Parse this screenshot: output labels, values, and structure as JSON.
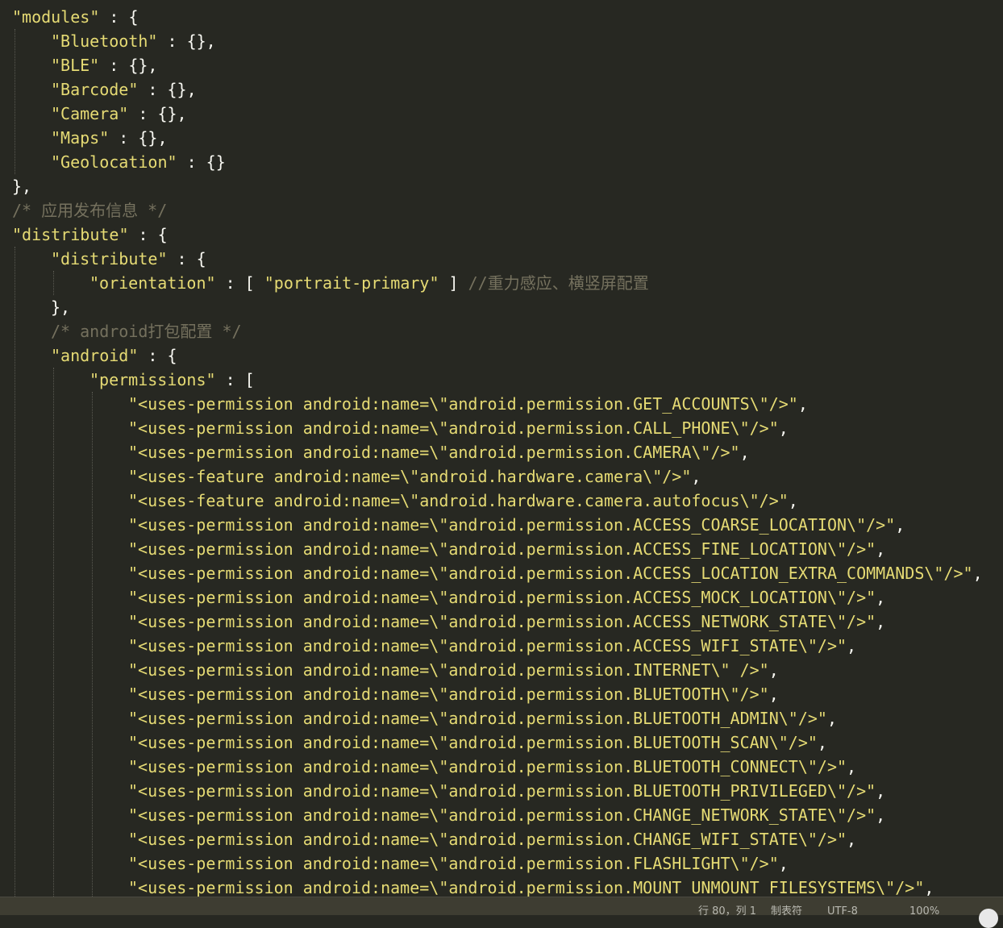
{
  "lines": [
    [
      {
        "t": "\"modules\"",
        "c": "k"
      },
      {
        "t": " : {",
        "c": "p"
      }
    ],
    [
      {
        "t": "\"Bluetooth\"",
        "c": "k"
      },
      {
        "t": " : {},",
        "c": "p"
      }
    ],
    [
      {
        "t": "\"BLE\"",
        "c": "k"
      },
      {
        "t": " : {},",
        "c": "p"
      }
    ],
    [
      {
        "t": "\"Barcode\"",
        "c": "k"
      },
      {
        "t": " : {},",
        "c": "p"
      }
    ],
    [
      {
        "t": "\"Camera\"",
        "c": "k"
      },
      {
        "t": " : {},",
        "c": "p"
      }
    ],
    [
      {
        "t": "\"Maps\"",
        "c": "k"
      },
      {
        "t": " : {},",
        "c": "p"
      }
    ],
    [
      {
        "t": "\"Geolocation\"",
        "c": "k"
      },
      {
        "t": " : {}",
        "c": "p"
      }
    ],
    [
      {
        "t": "},",
        "c": "p"
      }
    ],
    [
      {
        "t": "/* 应用发布信息 */",
        "c": "c"
      }
    ],
    [
      {
        "t": "\"distribute\"",
        "c": "k"
      },
      {
        "t": " : {",
        "c": "p"
      }
    ],
    [
      {
        "t": "\"distribute\"",
        "c": "k"
      },
      {
        "t": " : {",
        "c": "p"
      }
    ],
    [
      {
        "t": "\"orientation\"",
        "c": "k"
      },
      {
        "t": " : [ ",
        "c": "p"
      },
      {
        "t": "\"portrait-primary\"",
        "c": "k"
      },
      {
        "t": " ] ",
        "c": "p"
      },
      {
        "t": "//重力感应、横竖屏配置",
        "c": "c"
      }
    ],
    [
      {
        "t": "},",
        "c": "p"
      }
    ],
    [
      {
        "t": "/* android打包配置 */",
        "c": "c"
      }
    ],
    [
      {
        "t": "\"android\"",
        "c": "k"
      },
      {
        "t": " : {",
        "c": "p"
      }
    ],
    [
      {
        "t": "\"permissions\"",
        "c": "k"
      },
      {
        "t": " : [",
        "c": "p"
      }
    ],
    [
      {
        "t": "\"<uses-permission android:name=\\\"android.permission.GET_ACCOUNTS\\\"/>\"",
        "c": "k"
      },
      {
        "t": ",",
        "c": "p"
      }
    ],
    [
      {
        "t": "\"<uses-permission android:name=\\\"android.permission.CALL_PHONE\\\"/>\"",
        "c": "k"
      },
      {
        "t": ",",
        "c": "p"
      }
    ],
    [
      {
        "t": "\"<uses-permission android:name=\\\"android.permission.CAMERA\\\"/>\"",
        "c": "k"
      },
      {
        "t": ",",
        "c": "p"
      }
    ],
    [
      {
        "t": "\"<uses-feature android:name=\\\"android.hardware.camera\\\"/>\"",
        "c": "k"
      },
      {
        "t": ",",
        "c": "p"
      }
    ],
    [
      {
        "t": "\"<uses-feature android:name=\\\"android.hardware.camera.autofocus\\\"/>\"",
        "c": "k"
      },
      {
        "t": ",",
        "c": "p"
      }
    ],
    [
      {
        "t": "\"<uses-permission android:name=\\\"android.permission.ACCESS_COARSE_LOCATION\\\"/>\"",
        "c": "k"
      },
      {
        "t": ",",
        "c": "p"
      }
    ],
    [
      {
        "t": "\"<uses-permission android:name=\\\"android.permission.ACCESS_FINE_LOCATION\\\"/>\"",
        "c": "k"
      },
      {
        "t": ",",
        "c": "p"
      }
    ],
    [
      {
        "t": "\"<uses-permission android:name=\\\"android.permission.ACCESS_LOCATION_EXTRA_COMMANDS\\\"/>\"",
        "c": "k"
      },
      {
        "t": ",",
        "c": "p"
      }
    ],
    [
      {
        "t": "\"<uses-permission android:name=\\\"android.permission.ACCESS_MOCK_LOCATION\\\"/>\"",
        "c": "k"
      },
      {
        "t": ",",
        "c": "p"
      }
    ],
    [
      {
        "t": "\"<uses-permission android:name=\\\"android.permission.ACCESS_NETWORK_STATE\\\"/>\"",
        "c": "k"
      },
      {
        "t": ",",
        "c": "p"
      }
    ],
    [
      {
        "t": "\"<uses-permission android:name=\\\"android.permission.ACCESS_WIFI_STATE\\\"/>\"",
        "c": "k"
      },
      {
        "t": ",",
        "c": "p"
      }
    ],
    [
      {
        "t": "\"<uses-permission android:name=\\\"android.permission.INTERNET\\\" />\"",
        "c": "k"
      },
      {
        "t": ",",
        "c": "p"
      }
    ],
    [
      {
        "t": "\"<uses-permission android:name=\\\"android.permission.BLUETOOTH\\\"/>\"",
        "c": "k"
      },
      {
        "t": ",",
        "c": "p"
      }
    ],
    [
      {
        "t": "\"<uses-permission android:name=\\\"android.permission.BLUETOOTH_ADMIN\\\"/>\"",
        "c": "k"
      },
      {
        "t": ",",
        "c": "p"
      }
    ],
    [
      {
        "t": "\"<uses-permission android:name=\\\"android.permission.BLUETOOTH_SCAN\\\"/>\"",
        "c": "k"
      },
      {
        "t": ",",
        "c": "p"
      }
    ],
    [
      {
        "t": "\"<uses-permission android:name=\\\"android.permission.BLUETOOTH_CONNECT\\\"/>\"",
        "c": "k"
      },
      {
        "t": ",",
        "c": "p"
      }
    ],
    [
      {
        "t": "\"<uses-permission android:name=\\\"android.permission.BLUETOOTH_PRIVILEGED\\\"/>\"",
        "c": "k"
      },
      {
        "t": ",",
        "c": "p"
      }
    ],
    [
      {
        "t": "\"<uses-permission android:name=\\\"android.permission.CHANGE_NETWORK_STATE\\\"/>\"",
        "c": "k"
      },
      {
        "t": ",",
        "c": "p"
      }
    ],
    [
      {
        "t": "\"<uses-permission android:name=\\\"android.permission.CHANGE_WIFI_STATE\\\"/>\"",
        "c": "k"
      },
      {
        "t": ",",
        "c": "p"
      }
    ],
    [
      {
        "t": "\"<uses-permission android:name=\\\"android.permission.FLASHLIGHT\\\"/>\"",
        "c": "k"
      },
      {
        "t": ",",
        "c": "p"
      }
    ],
    [
      {
        "t": "\"<uses-permission android:name=\\\"android.permission.MOUNT_UNMOUNT_FILESYSTEMS\\\"/>\"",
        "c": "k"
      },
      {
        "t": ",",
        "c": "p"
      }
    ]
  ],
  "indents": [
    0,
    1,
    1,
    1,
    1,
    1,
    1,
    0,
    0,
    0,
    1,
    2,
    1,
    1,
    1,
    2,
    3,
    3,
    3,
    3,
    3,
    3,
    3,
    3,
    3,
    3,
    3,
    3,
    3,
    3,
    3,
    3,
    3,
    3,
    3,
    3,
    3
  ],
  "colors": {
    "background": "#272822",
    "string": "#e6db74",
    "punctuation": "#f8f8f2",
    "comment": "#75715e",
    "statusbar": "#3e3d32"
  },
  "statusbar": {
    "position": "行 80，列 1",
    "spaces": "制表符",
    "encoding": "UTF-8",
    "zoom": "100%"
  }
}
